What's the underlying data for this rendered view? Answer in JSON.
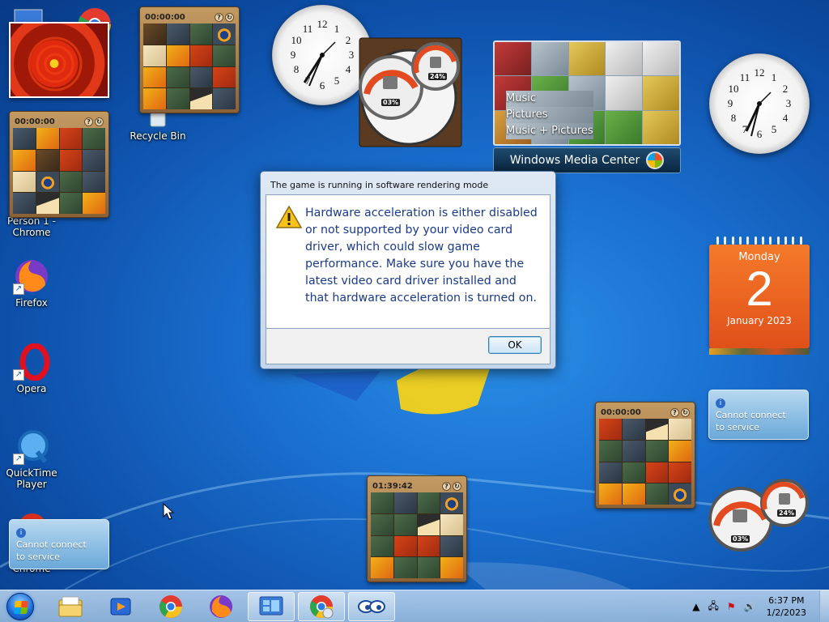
{
  "desktop": {
    "icons": [
      {
        "name": "Recycle Bin"
      },
      {
        "name": "Person 1 - Chrome"
      },
      {
        "name": "Firefox"
      },
      {
        "name": "Opera"
      },
      {
        "name": "QuickTime Player"
      },
      {
        "name": "Chrome"
      }
    ]
  },
  "gadgets": {
    "puzzle_times": [
      "00:00:00",
      "00:00:00",
      "00:00:00",
      "01:39:42"
    ],
    "meter": {
      "cpu": "03%",
      "memory": "24%"
    },
    "media_center": {
      "items": [
        "Music",
        "Pictures",
        "Music + Pictures"
      ],
      "title": "Windows Media Center"
    },
    "calendar": {
      "weekday": "Monday",
      "day": "2",
      "month_year": "January 2023"
    },
    "notify_text": "Cannot connect to service"
  },
  "dialog": {
    "title": "The game is running in software rendering mode",
    "message": "Hardware acceleration is either disabled or not supported by your video card driver, which could slow game performance. Make sure you have the latest video card driver installed and that hardware acceleration is turned on.",
    "ok_label": "OK"
  },
  "taskbar": {
    "time": "6:37 PM",
    "date": "1/2/2023"
  },
  "colors": {
    "accent": "#1a6fcf",
    "dialog_text": "#1a3a8a",
    "calendar": "#f0641e"
  }
}
